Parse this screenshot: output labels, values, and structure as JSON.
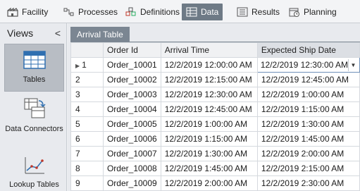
{
  "ribbon": {
    "tabs": [
      {
        "label": "Facility",
        "icon": "facility-icon"
      },
      {
        "label": "Processes",
        "icon": "processes-icon"
      },
      {
        "label": "Definitions",
        "icon": "definitions-icon"
      },
      {
        "label": "Data",
        "icon": "data-icon",
        "active": true
      },
      {
        "label": "Results",
        "icon": "results-icon"
      },
      {
        "label": "Planning",
        "icon": "planning-icon"
      }
    ]
  },
  "views": {
    "title": "Views",
    "collapse_glyph": "<",
    "items": [
      {
        "label": "Tables",
        "icon": "tables-icon",
        "active": true
      },
      {
        "label": "Data Connectors",
        "icon": "data-connectors-icon"
      },
      {
        "label": "Lookup Tables",
        "icon": "lookup-tables-icon"
      }
    ]
  },
  "table_tab": {
    "label": "Arrival Table"
  },
  "grid": {
    "columns": [
      "Order Id",
      "Arrival Time",
      "Expected Ship Date"
    ],
    "selected_column": 2,
    "rows": [
      {
        "n": "1",
        "order": "Order_10001",
        "arrival": "12/2/2019 12:00:00 AM",
        "ship": "12/2/2019 12:30:00 AM"
      },
      {
        "n": "2",
        "order": "Order_10002",
        "arrival": "12/2/2019 12:15:00 AM",
        "ship": "12/2/2019 12:45:00 AM"
      },
      {
        "n": "3",
        "order": "Order_10003",
        "arrival": "12/2/2019 12:30:00 AM",
        "ship": "12/2/2019 1:00:00 AM"
      },
      {
        "n": "4",
        "order": "Order_10004",
        "arrival": "12/2/2019 12:45:00 AM",
        "ship": "12/2/2019 1:15:00 AM"
      },
      {
        "n": "5",
        "order": "Order_10005",
        "arrival": "12/2/2019 1:00:00 AM",
        "ship": "12/2/2019 1:30:00 AM"
      },
      {
        "n": "6",
        "order": "Order_10006",
        "arrival": "12/2/2019 1:15:00 AM",
        "ship": "12/2/2019 1:45:00 AM"
      },
      {
        "n": "7",
        "order": "Order_10007",
        "arrival": "12/2/2019 1:30:00 AM",
        "ship": "12/2/2019 2:00:00 AM"
      },
      {
        "n": "8",
        "order": "Order_10008",
        "arrival": "12/2/2019 1:45:00 AM",
        "ship": "12/2/2019 2:15:00 AM"
      },
      {
        "n": "9",
        "order": "Order_10009",
        "arrival": "12/2/2019 2:00:00 AM",
        "ship": "12/2/2019 2:30:00 AM"
      }
    ]
  },
  "colors": {
    "active_tab": "#6e7a86",
    "subtab": "#7b8692",
    "edit_border": "#6e8fb8"
  }
}
